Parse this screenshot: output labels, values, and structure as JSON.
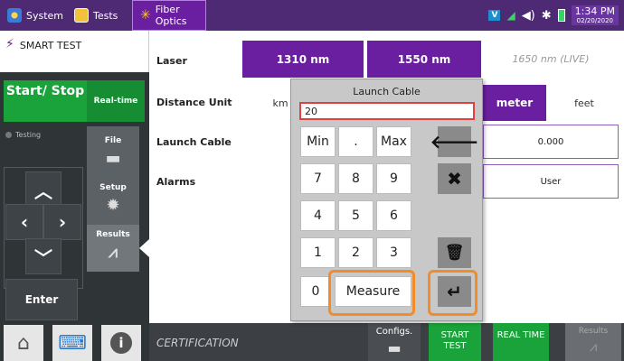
{
  "topbar": {
    "tabs": [
      {
        "label": "System",
        "icon": "gear-icon"
      },
      {
        "label": "Tests",
        "icon": "bert-icon"
      },
      {
        "label": "Fiber Optics",
        "icon": "fiber-icon"
      }
    ],
    "status": {
      "vt_badge": "V",
      "time": "1:34 PM",
      "date": "02/20/2020"
    }
  },
  "left": {
    "smart_test": "SMART TEST",
    "start_stop": "Start/ Stop",
    "real_time": "Real-time",
    "testing": "Testing",
    "file": "File",
    "setup": "Setup",
    "results": "Results",
    "enter": "Enter"
  },
  "form": {
    "laser_label": "Laser",
    "laser_options": [
      "1310 nm",
      "1550 nm",
      "1650 nm (LIVE)"
    ],
    "distance_label": "Distance Unit",
    "distance_km": "km",
    "distance_meter": "meter",
    "distance_feet": "feet",
    "launch_label": "Launch Cable",
    "launch_value": "0.000",
    "alarms_label": "Alarms",
    "alarms_value": "User"
  },
  "bottom": {
    "certification": "CERTIFICATION",
    "configs": "Configs.",
    "start_test": "START TEST",
    "real_time": "REAL TIME",
    "results": "Results"
  },
  "keypad": {
    "title": "Launch Cable",
    "value": "20",
    "keys": {
      "min": "Min",
      "dot": ".",
      "max": "Max",
      "k7": "7",
      "k8": "8",
      "k9": "9",
      "k4": "4",
      "k5": "5",
      "k6": "6",
      "k1": "1",
      "k2": "2",
      "k3": "3",
      "k0": "0",
      "measure": "Measure"
    }
  },
  "colors": {
    "accent_purple": "#6a1fa0",
    "green": "#1aa23b",
    "highlight_orange": "#f28c28"
  }
}
